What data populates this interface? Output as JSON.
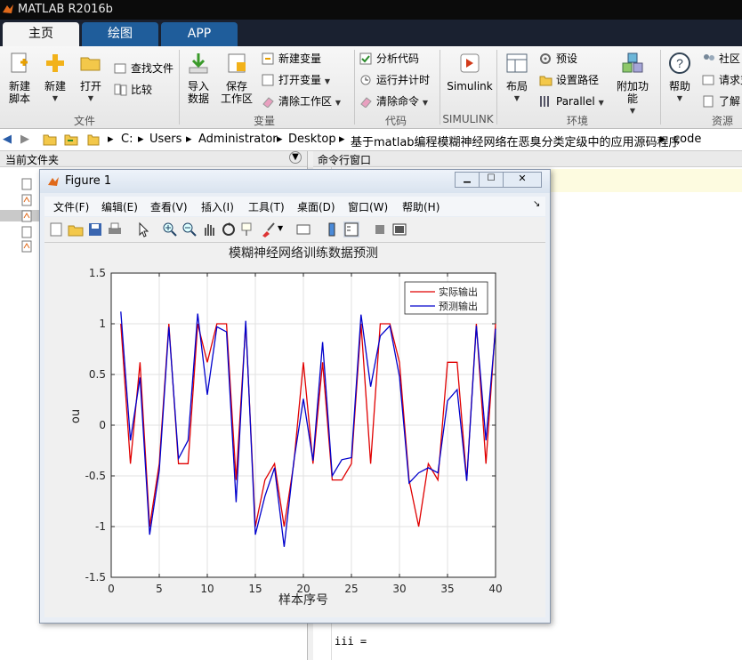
{
  "app": {
    "title": "MATLAB R2016b"
  },
  "tabs": [
    {
      "label": "主页"
    },
    {
      "label": "绘图"
    },
    {
      "label": "APP"
    }
  ],
  "ribbon": {
    "file_group": {
      "label": "文件",
      "new_script": "新建\n脚本",
      "new": "新建",
      "open": "打开",
      "find_files": "查找文件",
      "compare": "比较"
    },
    "variable_group": {
      "label": "变量",
      "import": "导入\n数据",
      "save_ws": "保存\n工作区",
      "new_var": "新建变量",
      "open_var": "打开变量",
      "clear_ws": "清除工作区"
    },
    "code_group": {
      "label": "代码",
      "analyze": "分析代码",
      "run_time": "运行并计时",
      "clear_cmd": "清除命令"
    },
    "simulink_group": {
      "label": "SIMULINK",
      "simulink": "Simulink"
    },
    "env_group": {
      "label": "环境",
      "layout": "布局",
      "prefs": "预设",
      "set_path": "设置路径",
      "parallel": "Parallel",
      "addons": "附加功能"
    },
    "resources_group": {
      "label": "资源",
      "help": "帮助",
      "community": "社区",
      "request": "请求支",
      "learn": "了解"
    }
  },
  "address": {
    "crumbs": [
      "C:",
      "Users",
      "Administrator",
      "Desktop",
      "基于matlab编程模糊神经网络在恶臭分类定级中的应用源码程序",
      "code"
    ]
  },
  "panels": {
    "current_folder": "当前文件夹",
    "command_window": "命令行窗口",
    "command_text": "iii ="
  },
  "figure": {
    "title": "Figure 1",
    "menus": [
      "文件(F)",
      "编辑(E)",
      "查看(V)",
      "插入(I)",
      "工具(T)",
      "桌面(D)",
      "窗口(W)",
      "帮助(H)"
    ]
  },
  "chart_data": {
    "type": "line",
    "title": "模糊神经网络训练数据预测",
    "xlabel": "样本序号",
    "ylabel": "ou",
    "xlim": [
      0,
      40
    ],
    "ylim": [
      -1.5,
      1.5
    ],
    "xticks": [
      0,
      5,
      10,
      15,
      20,
      25,
      30,
      35,
      40
    ],
    "yticks": [
      -1.5,
      -1,
      -0.5,
      0,
      0.5,
      1,
      1.5
    ],
    "grid": true,
    "legend_position": "top-right",
    "x": [
      1,
      2,
      3,
      4,
      5,
      6,
      7,
      8,
      9,
      10,
      11,
      12,
      13,
      14,
      15,
      16,
      17,
      18,
      19,
      20,
      21,
      22,
      23,
      24,
      25,
      26,
      27,
      28,
      29,
      30,
      31,
      32,
      33,
      34,
      35,
      36,
      37,
      38,
      39,
      40
    ],
    "series": [
      {
        "name": "实际输出",
        "color": "#e00000",
        "values": [
          1,
          -0.38,
          0.62,
          -1,
          -0.38,
          1,
          -0.38,
          -0.38,
          1,
          0.62,
          1,
          1,
          -0.54,
          1,
          -1,
          -0.54,
          -0.38,
          -1,
          -0.38,
          0.62,
          -0.38,
          0.62,
          -0.54,
          -0.54,
          -0.38,
          1,
          -0.38,
          1,
          1,
          0.62,
          -0.54,
          -1,
          -0.38,
          -0.54,
          0.62,
          0.62,
          -0.54,
          1,
          -0.38,
          1
        ]
      },
      {
        "name": "预测输出",
        "color": "#0000cc",
        "values": [
          1.12,
          -0.15,
          0.47,
          -1.08,
          -0.45,
          0.97,
          -0.33,
          -0.15,
          1.1,
          0.3,
          0.97,
          0.92,
          -0.76,
          1.03,
          -1.08,
          -0.7,
          -0.42,
          -1.2,
          -0.36,
          0.26,
          -0.35,
          0.82,
          -0.5,
          -0.34,
          -0.32,
          1.09,
          0.38,
          0.88,
          0.98,
          0.48,
          -0.57,
          -0.47,
          -0.42,
          -0.47,
          0.24,
          0.35,
          -0.55,
          0.98,
          -0.15,
          0.95
        ]
      }
    ]
  }
}
